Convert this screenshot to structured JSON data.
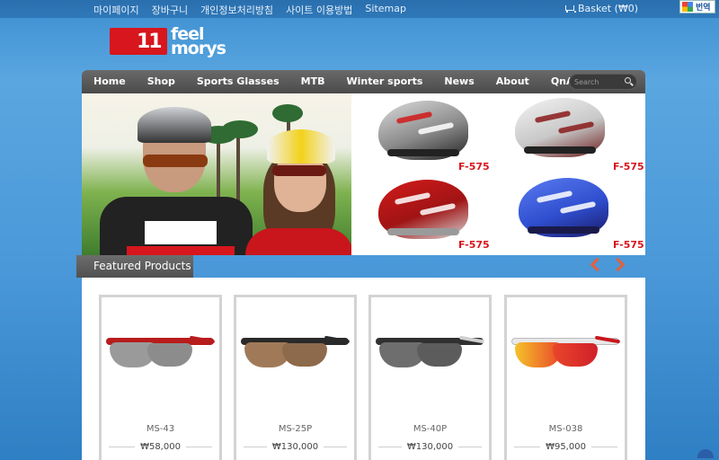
{
  "topbar": {
    "links": [
      "마이페이지",
      "장바구니",
      "개인정보처리방침",
      "사이트 이용방법",
      "Sitemap"
    ],
    "basket": "Basket (₩0)",
    "translate_label": "번역"
  },
  "logo": {
    "mark": "11",
    "text_line1": "feel",
    "text_line2": "morys"
  },
  "nav": {
    "items": [
      "Home",
      "Shop",
      "Sports Glasses",
      "MTB",
      "Winter sports",
      "News",
      "About",
      "QnA"
    ],
    "search_placeholder": "Search"
  },
  "banner": {
    "products": [
      {
        "model": "F-575",
        "colors": [
          "#c8c8c8",
          "#222222",
          "#d01a1a"
        ]
      },
      {
        "model": "F-575",
        "colors": [
          "#e8e8e8",
          "#8a1a1a",
          "#222222"
        ]
      },
      {
        "model": "F-575",
        "colors": [
          "#c8161c",
          "#e8e8e8",
          "#8a8a8a"
        ]
      },
      {
        "model": "F-575",
        "colors": [
          "#2f4fd0",
          "#e0e0e0",
          "#1a1a6a"
        ]
      }
    ]
  },
  "featured": {
    "title": "Featured Products"
  },
  "products": [
    {
      "name": "MS-43",
      "price": "₩58,000",
      "frame": "#b81c1c",
      "lens": "#9a9a9a"
    },
    {
      "name": "MS-25P",
      "price": "₩130,000",
      "frame": "#2a2a2a",
      "lens": "#a07a58"
    },
    {
      "name": "MS-40P",
      "price": "₩130,000",
      "frame": "#303030",
      "lens": "#6e6e6e"
    },
    {
      "name": "MS-038",
      "price": "₩95,000",
      "frame": "#e8e8e8",
      "lens": "#e9462a"
    }
  ],
  "colors": {
    "accent": "#e4603a",
    "brand": "#d7161d"
  }
}
